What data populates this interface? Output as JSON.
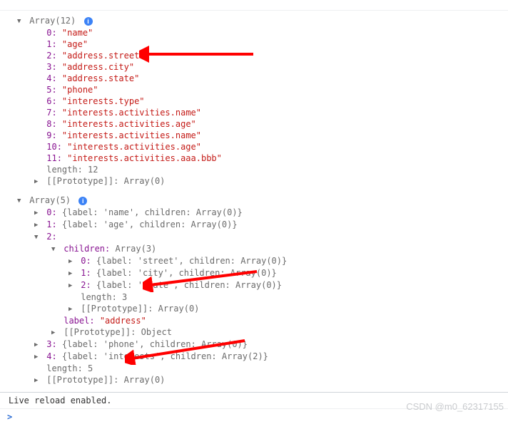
{
  "truncated_hint": "。。。。。。。。。。。。。。。。。。。。",
  "array1": {
    "header": "Array(12)",
    "items": [
      {
        "idx": "0",
        "val": "\"name\""
      },
      {
        "idx": "1",
        "val": "\"age\""
      },
      {
        "idx": "2",
        "val": "\"address.street\""
      },
      {
        "idx": "3",
        "val": "\"address.city\""
      },
      {
        "idx": "4",
        "val": "\"address.state\""
      },
      {
        "idx": "5",
        "val": "\"phone\""
      },
      {
        "idx": "6",
        "val": "\"interests.type\""
      },
      {
        "idx": "7",
        "val": "\"interests.activities.name\""
      },
      {
        "idx": "8",
        "val": "\"interests.activities.age\""
      },
      {
        "idx": "9",
        "val": "\"interests.activities.name\""
      },
      {
        "idx": "10",
        "val": "\"interests.activities.age\""
      },
      {
        "idx": "11",
        "val": "\"interests.activities.aaa.bbb\""
      }
    ],
    "length_label": "length",
    "length_val": "12",
    "proto_label": "[[Prototype]]",
    "proto_val": "Array(0)"
  },
  "array2": {
    "header": "Array(5)",
    "row0": "{label: 'name', children: Array(0)}",
    "row1": "{label: 'age', children: Array(0)}",
    "row2": {
      "idx": "2",
      "children_label": "children",
      "children_val": "Array(3)",
      "c0": "{label: 'street', children: Array(0)}",
      "c1": "{label: 'city', children: Array(0)}",
      "c2": "{label: 'state', children: Array(0)}",
      "clen_label": "length",
      "clen_val": "3",
      "cproto_label": "[[Prototype]]",
      "cproto_val": "Array(0)",
      "label_label": "label",
      "label_val": "\"address\"",
      "proto_label": "[[Prototype]]",
      "proto_val": "Object"
    },
    "row3": "{label: 'phone', children: Array(0)}",
    "row4": "{label: 'interests', children: Array(2)}",
    "length_label": "length",
    "length_val": "5",
    "proto_label": "[[Prototype]]",
    "proto_val": "Array(0)"
  },
  "console_msg": "Live reload enabled.",
  "watermark": "CSDN @m0_62317155"
}
